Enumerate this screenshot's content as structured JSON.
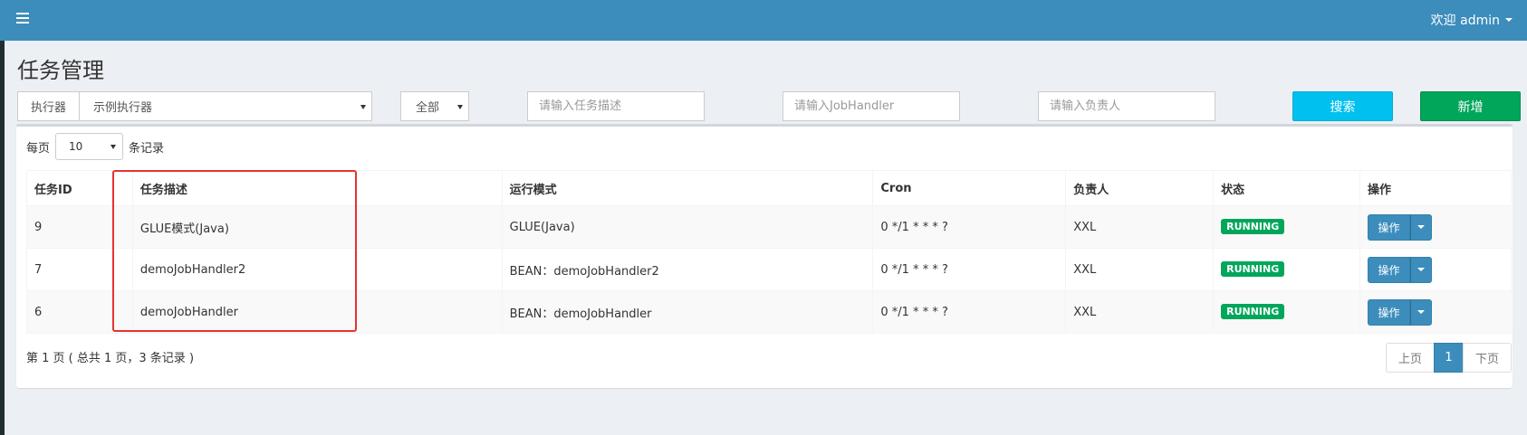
{
  "header": {
    "user_greeting": "欢迎 admin"
  },
  "page": {
    "title": "任务管理"
  },
  "filters": {
    "executor_label": "执行器",
    "executor_value": "示例执行器",
    "status_value": "全部",
    "desc_placeholder": "请输入任务描述",
    "handler_placeholder": "请输入JobHandler",
    "author_placeholder": "请输入负责人",
    "search_label": "搜索",
    "add_label": "新增"
  },
  "page_size": {
    "prefix": "每页",
    "value": "10",
    "suffix": "条记录"
  },
  "table": {
    "columns": [
      "任务ID",
      "任务描述",
      "运行模式",
      "Cron",
      "负责人",
      "状态",
      "操作"
    ],
    "rows": [
      {
        "id": "9",
        "desc": "GLUE模式(Java)",
        "mode": "GLUE(Java)",
        "cron": "0 */1 * * * ?",
        "author": "XXL",
        "status": "RUNNING",
        "action": "操作"
      },
      {
        "id": "7",
        "desc": "demoJobHandler2",
        "mode": "BEAN：demoJobHandler2",
        "cron": "0 */1 * * * ?",
        "author": "XXL",
        "status": "RUNNING",
        "action": "操作"
      },
      {
        "id": "6",
        "desc": "demoJobHandler",
        "mode": "BEAN：demoJobHandler",
        "cron": "0 */1 * * * ?",
        "author": "XXL",
        "status": "RUNNING",
        "action": "操作"
      }
    ]
  },
  "pagination": {
    "info": "第 1 页 ( 总共 1 页，3 条记录 )",
    "prev_label": "上页",
    "current": "1",
    "next_label": "下页"
  },
  "colors": {
    "header_bg": "#3c8dbc",
    "search_btn": "#00c0ef",
    "add_btn": "#00a65a",
    "status_running": "#00a65a",
    "highlight_box": "#e8322f"
  },
  "icons": {
    "menu": "hamburger-icon",
    "dropdown": "caret-down-icon"
  }
}
